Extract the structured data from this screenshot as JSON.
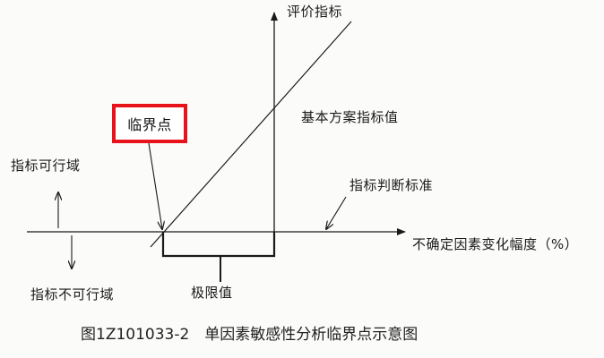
{
  "diagram": {
    "y_axis_label": "评价指标",
    "x_axis_label": "不确定因素变化幅度（%）",
    "base_value_label": "基本方案指标值",
    "criterion_label": "指标判断标准",
    "critical_point_label": "临界点",
    "feasible_label": "指标可行域",
    "infeasible_label": "指标不可行域",
    "limit_label": "极限值",
    "highlight_color": "#e8121b"
  },
  "caption": "图1Z101033-2　单因素敏感性分析临界点示意图"
}
